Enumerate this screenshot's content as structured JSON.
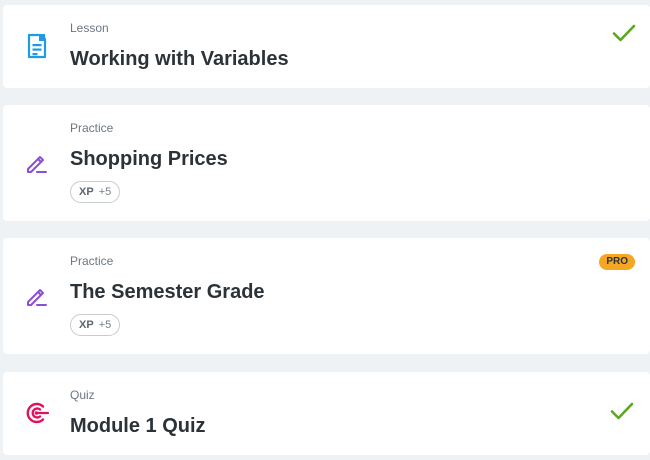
{
  "items": [
    {
      "kind": "Lesson",
      "title": "Working with Variables",
      "icon": "lesson-icon",
      "completed": true
    },
    {
      "kind": "Practice",
      "title": "Shopping Prices",
      "icon": "practice-pencil-icon",
      "xp_label": "XP",
      "xp_value": "+5"
    },
    {
      "kind": "Practice",
      "title": "The Semester Grade",
      "icon": "practice-pencil-icon",
      "badge": "PRO",
      "xp_label": "XP",
      "xp_value": "+5"
    },
    {
      "kind": "Quiz",
      "title": "Module 1 Quiz",
      "icon": "quiz-target-icon",
      "completed": true
    }
  ],
  "colors": {
    "lesson_icon": "#1e9be4",
    "practice_icon": "#8a4fd6",
    "quiz_icon": "#e0115f",
    "check": "#5aa820",
    "pro_badge": "#f5a623"
  }
}
